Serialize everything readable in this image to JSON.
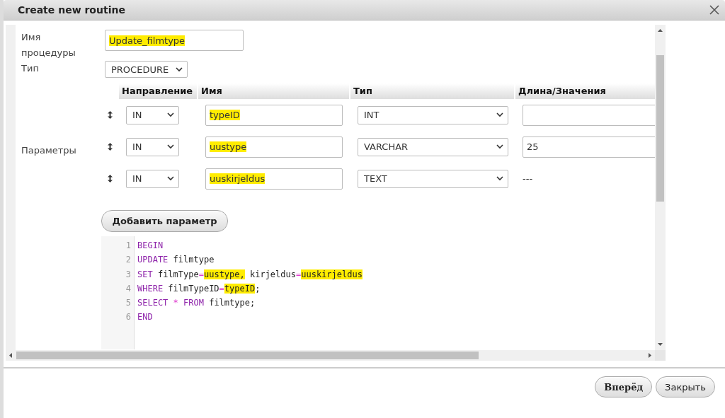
{
  "dialog": {
    "title": "Create new routine"
  },
  "form": {
    "name_label": "Имя процедуры",
    "name_value": "Update_filmtype",
    "name_highlighted": true,
    "type_label": "Тип",
    "type_value": "PROCEDURE",
    "params_label": "Параметры"
  },
  "params": {
    "columns": [
      "Направление",
      "Имя",
      "Тип",
      "Длина/Значения"
    ],
    "rows": [
      {
        "direction": "IN",
        "name": "typeID",
        "name_highlighted": true,
        "type": "INT",
        "kind": "field"
      },
      {
        "direction": "IN",
        "name": "uustype",
        "name_highlighted": true,
        "type": "VARCHAR",
        "kind": "field",
        "length": "25"
      },
      {
        "direction": "IN",
        "name": "uuskirjeldus",
        "name_highlighted": true,
        "type": "TEXT",
        "kind": "text",
        "length": "---"
      }
    ]
  },
  "add_button": "Добавить параметр",
  "code": {
    "lines": [
      {
        "number": "1",
        "tokens": [
          {
            "kind": "keyword",
            "text": "BEGIN",
            "highlighted": false
          }
        ]
      },
      {
        "number": "2",
        "tokens": [
          {
            "kind": "keyword",
            "text": "UPDATE",
            "highlighted": false
          },
          {
            "kind": "plain",
            "text": " filmtype",
            "highlighted": false
          }
        ]
      },
      {
        "number": "3",
        "tokens": [
          {
            "kind": "keyword",
            "text": "SET",
            "highlighted": false
          },
          {
            "kind": "plain",
            "text": " filmType",
            "highlighted": false
          },
          {
            "kind": "operator",
            "text": "=",
            "highlighted": false
          },
          {
            "kind": "plain",
            "text": "uustype,",
            "highlighted": true
          },
          {
            "kind": "plain",
            "text": " kirjeldus",
            "highlighted": false
          },
          {
            "kind": "operator",
            "text": "=",
            "highlighted": false
          },
          {
            "kind": "plain",
            "text": "uuskirjeldus",
            "highlighted": true
          }
        ]
      },
      {
        "number": "4",
        "tokens": [
          {
            "kind": "keyword",
            "text": "WHERE",
            "highlighted": false
          },
          {
            "kind": "plain",
            "text": " filmTypeID",
            "highlighted": false
          },
          {
            "kind": "operator",
            "text": "=",
            "highlighted": false
          },
          {
            "kind": "plain",
            "text": "typeID",
            "highlighted": true
          },
          {
            "kind": "plain",
            "text": ";",
            "highlighted": false
          }
        ]
      },
      {
        "number": "5",
        "tokens": [
          {
            "kind": "keyword",
            "text": "SELECT",
            "highlighted": false
          },
          {
            "kind": "operator",
            "text": " *",
            "highlighted": false
          },
          {
            "kind": "keyword",
            "text": " FROM",
            "highlighted": false
          },
          {
            "kind": "plain",
            "text": " filmtype;",
            "highlighted": false
          }
        ]
      },
      {
        "number": "6",
        "tokens": [
          {
            "kind": "keyword",
            "text": "END",
            "highlighted": false
          }
        ]
      }
    ]
  },
  "buttons": [
    {
      "label": "Вперёд",
      "primary": true
    },
    {
      "label": "Закрыть",
      "primary": false
    }
  ]
}
